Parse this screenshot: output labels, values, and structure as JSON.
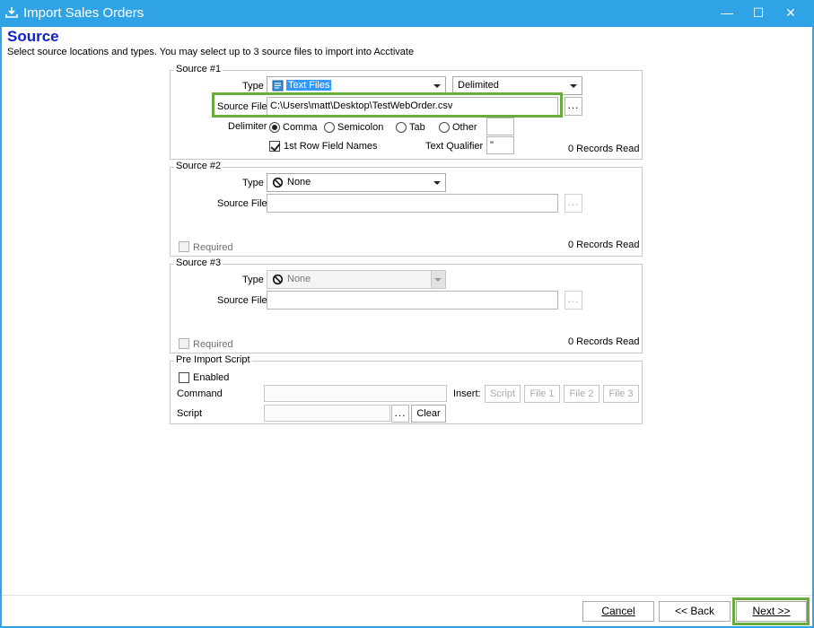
{
  "window": {
    "title": "Import Sales Orders",
    "minimize": "—",
    "maximize": "☐",
    "close": "✕"
  },
  "page": {
    "heading": "Source",
    "subheading": "Select source locations and types. You may select up to 3 source files to import into Acctivate"
  },
  "source1": {
    "group_title": "Source #1",
    "type_label": "Type",
    "type_value": "Text Files",
    "format_value": "Delimited",
    "source_file_label": "Source File",
    "source_file_value": "C:\\Users\\matt\\Desktop\\TestWebOrder.csv",
    "browse_label": "...",
    "delimiter_label": "Delimiter",
    "delimiter_options": [
      "Comma",
      "Semicolon",
      "Tab",
      "Other"
    ],
    "delimiter_selected": "Comma",
    "other_value": "",
    "first_row_label": "1st Row Field Names",
    "first_row_checked": true,
    "text_qualifier_label": "Text Qualifier",
    "text_qualifier_value": "\"",
    "records_read": "0 Records Read"
  },
  "source2": {
    "group_title": "Source #2",
    "type_label": "Type",
    "type_value": "None",
    "source_file_label": "Source File",
    "source_file_value": "",
    "browse_label": "...",
    "required_label": "Required",
    "records_read": "0 Records Read"
  },
  "source3": {
    "group_title": "Source #3",
    "type_label": "Type",
    "type_value": "None",
    "source_file_label": "Source File",
    "source_file_value": "",
    "browse_label": "...",
    "required_label": "Required",
    "records_read": "0 Records Read"
  },
  "pre_import": {
    "group_title": "Pre Import Script",
    "enabled_label": "Enabled",
    "command_label": "Command",
    "command_value": "",
    "insert_label": "Insert:",
    "insert_buttons": [
      "Script",
      "File 1",
      "File 2",
      "File 3"
    ],
    "script_label": "Script",
    "script_value": "",
    "browse_label": "...",
    "clear_label": "Clear"
  },
  "footer": {
    "cancel_label": "Cancel",
    "back_label": "<< Back",
    "next_label": "Next >>"
  },
  "colors": {
    "titlebar": "#2fa3e6",
    "heading": "#1023c8",
    "highlight": "#6aab3b"
  }
}
